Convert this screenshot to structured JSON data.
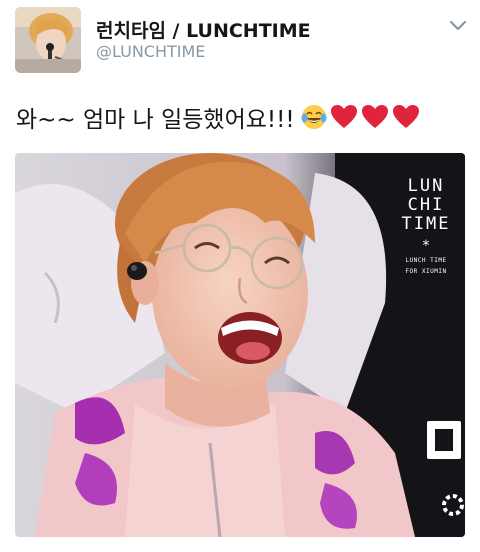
{
  "header": {
    "display_name": "런치타임 / LUNCHTIME",
    "handle": "@LUNCHTIME"
  },
  "tweet": {
    "text": "와~~ 엄마 나 일등했어요!!!",
    "emojis": [
      "face-with-tears-of-joy",
      "red-heart",
      "red-heart",
      "red-heart"
    ]
  },
  "media": {
    "overlay_title_lines": [
      "LUN",
      "CHI",
      "TIME"
    ],
    "overlay_star": "*",
    "overlay_sub_lines": [
      "LUNCH TIME",
      "FOR XIUMIN"
    ]
  },
  "colors": {
    "text": "#14171a",
    "secondary": "#8899a6",
    "heart": "#e0243c",
    "emoji_face": "#ffcc4d"
  }
}
